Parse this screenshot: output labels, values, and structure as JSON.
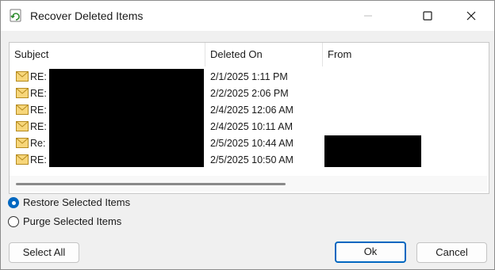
{
  "window": {
    "title": "Recover Deleted Items"
  },
  "columns": {
    "subject": "Subject",
    "deleted_on": "Deleted On",
    "from": "From"
  },
  "items": [
    {
      "subject": "RE:",
      "deleted_on": "2/1/2025 1:11 PM"
    },
    {
      "subject": "RE:",
      "deleted_on": "2/2/2025 2:06 PM"
    },
    {
      "subject": "RE:",
      "deleted_on": "2/4/2025 12:06 AM"
    },
    {
      "subject": "RE:",
      "deleted_on": "2/4/2025 10:11 AM"
    },
    {
      "subject": "Re:",
      "deleted_on": "2/5/2025 10:44 AM"
    },
    {
      "subject": "RE:",
      "deleted_on": "2/5/2025 10:50 AM"
    }
  ],
  "options": {
    "restore_label": "Restore Selected Items",
    "purge_label": "Purge Selected Items",
    "selected": "restore"
  },
  "buttons": {
    "select_all": "Select All",
    "ok": "Ok",
    "cancel": "Cancel"
  },
  "colors": {
    "accent": "#0067c0",
    "redaction": "#000000"
  }
}
